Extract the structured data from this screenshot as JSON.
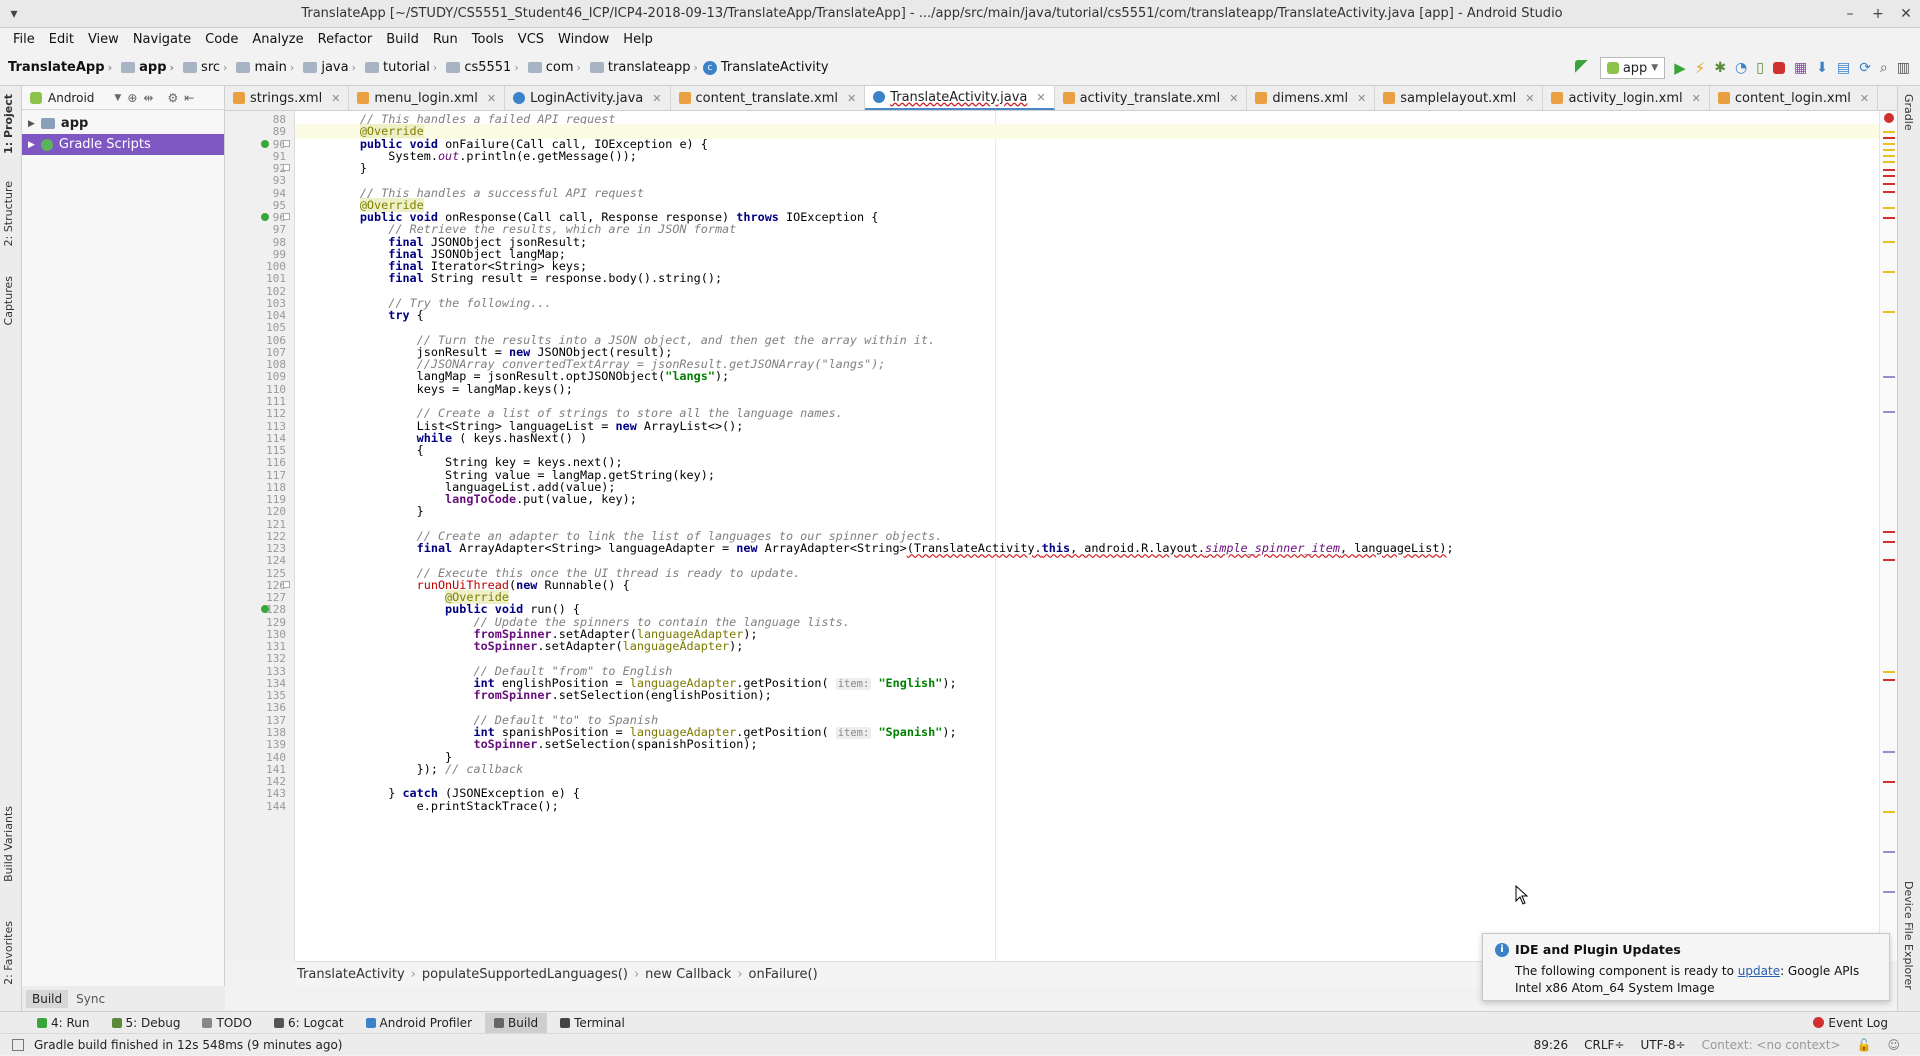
{
  "window": {
    "title": "TranslateApp [~/STUDY/CS5551_Student46_ICP/ICP4-2018-09-13/TranslateApp/TranslateApp] - .../app/src/main/java/tutorial/cs5551/com/translateapp/TranslateActivity.java [app] - Android Studio"
  },
  "menu": [
    "File",
    "Edit",
    "View",
    "Navigate",
    "Code",
    "Analyze",
    "Refactor",
    "Build",
    "Run",
    "Tools",
    "VCS",
    "Window",
    "Help"
  ],
  "breadcrumb": [
    "TranslateApp",
    "app",
    "src",
    "main",
    "java",
    "tutorial",
    "cs5551",
    "com",
    "translateapp",
    "TranslateActivity"
  ],
  "toolbar": {
    "run_config": "app"
  },
  "project": {
    "view_label": "Android",
    "items": [
      {
        "label": "app"
      },
      {
        "label": "Gradle Scripts"
      }
    ]
  },
  "left_tabs": [
    "1: Project",
    "2: Structure",
    "Captures",
    "Build Variants",
    "2: Favorites"
  ],
  "right_tabs": [
    "Gradle",
    "Device File Explorer"
  ],
  "tabs": [
    {
      "label": "strings.xml",
      "kind": "xml"
    },
    {
      "label": "menu_login.xml",
      "kind": "xml"
    },
    {
      "label": "LoginActivity.java",
      "kind": "java"
    },
    {
      "label": "content_translate.xml",
      "kind": "xml"
    },
    {
      "label": "TranslateActivity.java",
      "kind": "java",
      "active": true
    },
    {
      "label": "activity_translate.xml",
      "kind": "xml"
    },
    {
      "label": "dimens.xml",
      "kind": "xml"
    },
    {
      "label": "samplelayout.xml",
      "kind": "xml"
    },
    {
      "label": "activity_login.xml",
      "kind": "xml"
    },
    {
      "label": "content_login.xml",
      "kind": "xml"
    }
  ],
  "editor": {
    "first_line": 88,
    "lines": [
      "        <c>// This handles a failed API request</c>",
      "        <a>@Override</a>",
      "        <k>public void</k> onFailure(Call call, IOException e) {",
      "            System.<fi>out</fi>.println(e.getMessage());",
      "        }",
      "",
      "        <c>// This handles a successful API request</c>",
      "        <a>@Override</a>",
      "        <k>public void</k> onResponse(Call call, Response response) <k>throws</k> IOException {",
      "            <c>// Retrieve the results, which are in JSON format</c>",
      "            <k>final</k> JSONObject jsonResult;",
      "            <k>final</k> JSONObject langMap;",
      "            <k>final</k> Iterator&lt;String&gt; keys;",
      "            <k>final</k> String result = response.body().string();",
      "",
      "            <c>// Try the following...</c>",
      "            <k>try</k> {",
      "",
      "                <c>// Turn the results into a JSON object, and then get the array within it.</c>",
      "                jsonResult = <k>new</k> JSONObject(result);",
      "                <c>//JSONArray convertedTextArray = jsonResult.getJSONArray(\"langs\");</c>",
      "                langMap = jsonResult.optJSONObject(<s>\"langs\"</s>);",
      "                keys = langMap.keys();",
      "",
      "                <c>// Create a list of strings to store all the language names.</c>",
      "                List&lt;String&gt; languageList = <k>new</k> ArrayList&lt;&gt;();",
      "                <k>while</k> ( keys.hasNext() )",
      "                {",
      "                    String key = keys.next();",
      "                    String value = langMap.getString(key);",
      "                    languageList.add(value);",
      "                    <f>langToCode</f>.put(value, key);",
      "                }",
      "",
      "                <c>// Create an adapter to link the list of languages to our spinner objects.</c>",
      "                <k>final</k> ArrayAdapter&lt;String&gt; languageAdapter = <k>new</k> ArrayAdapter&lt;String&gt;<u>(TranslateActivity.<k>this</k>, android.R.layout.<fi>simple_spinner_item</fi>, languageList)</u>;",
      "",
      "                <c>// Execute this once the UI thread is ready to update.</c>",
      "                <r>runOnUiThread</r>(<k>new</k> Runnable() {",
      "                    <a>@Override</a>",
      "                    <k>public void</k> run() {",
      "                        <c>// Update the spinners to contain the language lists.</c>",
      "                        <f>fromSpinner</f>.setAdapter(<m>languageAdapter</m>);",
      "                        <f>toSpinner</f>.setAdapter(<m>languageAdapter</m>);",
      "",
      "                        <c>// Default \"from\" to English</c>",
      "                        <k>int</k> englishPosition = <m>languageAdapter</m>.getPosition( <h>item:</h> <s>\"English\"</s>);",
      "                        <f>fromSpinner</f>.setSelection(englishPosition);",
      "",
      "                        <c>// Default \"to\" to Spanish</c>",
      "                        <k>int</k> spanishPosition = <m>languageAdapter</m>.getPosition( <h>item:</h> <s>\"Spanish\"</s>);",
      "                        <f>toSpinner</f>.setSelection(spanishPosition);",
      "                    }",
      "                }); <c>// callback</c>",
      "",
      "            } <k>catch</k> (JSONException e) {",
      "                e.printStackTrace();"
    ]
  },
  "code_breadcrumb": [
    "TranslateActivity",
    "populateSupportedLanguages()",
    "new Callback",
    "onFailure()"
  ],
  "build_tabs": [
    "Build",
    "Sync"
  ],
  "tool_windows": [
    "4: Run",
    "5: Debug",
    "TODO",
    "6: Logcat",
    "Android Profiler",
    "Build",
    "Terminal"
  ],
  "event_log": "Event Log",
  "status": {
    "message": "Gradle build finished in 12s 548ms (9 minutes ago)",
    "position": "89:26",
    "line_sep": "CRLF÷",
    "encoding": "UTF-8÷",
    "context": "Context: <no context>"
  },
  "notification": {
    "title": "IDE and Plugin Updates",
    "text_before": "The following component is ready to ",
    "link": "update",
    "text_after": ": Google APIs Intel x86 Atom_64 System Image"
  },
  "colors": {
    "accent": "#4a88c7",
    "selection": "#7e57c2",
    "run": "#3aa53a",
    "stop": "#d03030"
  }
}
